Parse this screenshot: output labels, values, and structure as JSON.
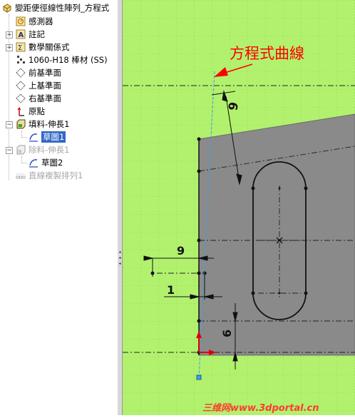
{
  "tree": {
    "root": {
      "label": "變距便徑線性陣列_方程式",
      "icon": "part-icon"
    },
    "items": [
      {
        "label": "感測器",
        "icon": "sensor-icon"
      },
      {
        "label": "註記",
        "icon": "annotations-icon"
      },
      {
        "label": "數學關係式",
        "icon": "equations-icon"
      },
      {
        "label": "1060-H18 棒材 (SS)",
        "icon": "material-icon"
      },
      {
        "label": "前基準面",
        "icon": "plane-icon"
      },
      {
        "label": "上基準面",
        "icon": "plane-icon"
      },
      {
        "label": "右基準面",
        "icon": "plane-icon"
      },
      {
        "label": "原點",
        "icon": "origin-icon"
      },
      {
        "label": "填料-伸長1",
        "icon": "extrude-icon"
      },
      {
        "label": "草圖1",
        "icon": "sketch-icon"
      },
      {
        "label": "除料-伸長1",
        "icon": "cut-extrude-icon"
      },
      {
        "label": "草圖2",
        "icon": "sketch-icon"
      },
      {
        "label": "直線複製排列1",
        "icon": "linear-pattern-icon"
      }
    ]
  },
  "canvas": {
    "annotation": "方程式曲線",
    "dims": {
      "top": "6",
      "left_upper": "9",
      "left_lower": "1",
      "bottom": "6"
    },
    "watermark": "三维网www.3dportal.cn",
    "colors": {
      "background": "#b2f16e",
      "part": "#8a8a8a",
      "annotation": "#ff0000",
      "curve": "#3d9ee8"
    }
  }
}
